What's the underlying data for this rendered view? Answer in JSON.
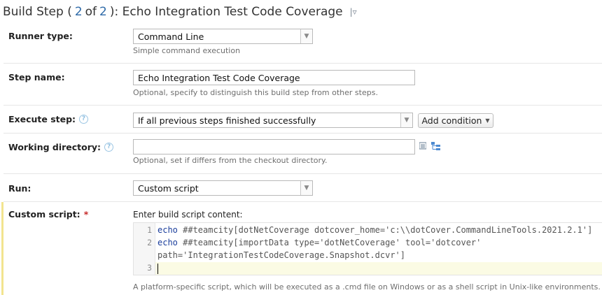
{
  "title": {
    "prefix": "Build Step (",
    "step_current": "2",
    "of_word": " of ",
    "step_total": "2",
    "suffix": "): Echo Integration Test Code Coverage"
  },
  "fields": {
    "runner_type": {
      "label": "Runner type:",
      "value": "Command Line",
      "hint": "Simple command execution"
    },
    "step_name": {
      "label": "Step name:",
      "value": "Echo Integration Test Code Coverage",
      "hint": "Optional, specify to distinguish this build step from other steps."
    },
    "execute_step": {
      "label": "Execute step:",
      "value": "If all previous steps finished successfully",
      "add_condition_label": "Add condition"
    },
    "working_directory": {
      "label": "Working directory:",
      "value": "",
      "hint": "Optional, set if differs from the checkout directory."
    },
    "run": {
      "label": "Run:",
      "value": "Custom script"
    },
    "custom_script": {
      "label": "Custom script:",
      "required_mark": "*",
      "editor_caption": "Enter build script content:",
      "line_numbers": [
        "1",
        "2",
        "3"
      ],
      "lines": [
        {
          "cmd": "echo",
          "rest": " ##teamcity[dotNetCoverage dotcover_home='c:\\\\dotCover.CommandLineTools.2021.2.1']"
        },
        {
          "cmd": "echo",
          "rest": " ##teamcity[importData type='dotNetCoverage' tool='dotcover'"
        },
        {
          "cmd": "",
          "rest": "path='IntegrationTestCodeCoverage.Snapshot.dcvr']"
        },
        {
          "cmd": "",
          "rest": ""
        }
      ],
      "hint": "A platform-specific script, which will be executed as a .cmd file on Windows or as a shell script in Unix-like environments."
    }
  },
  "icons": {
    "help": "?",
    "dropdown": "▼",
    "title_menu": "|▿"
  }
}
